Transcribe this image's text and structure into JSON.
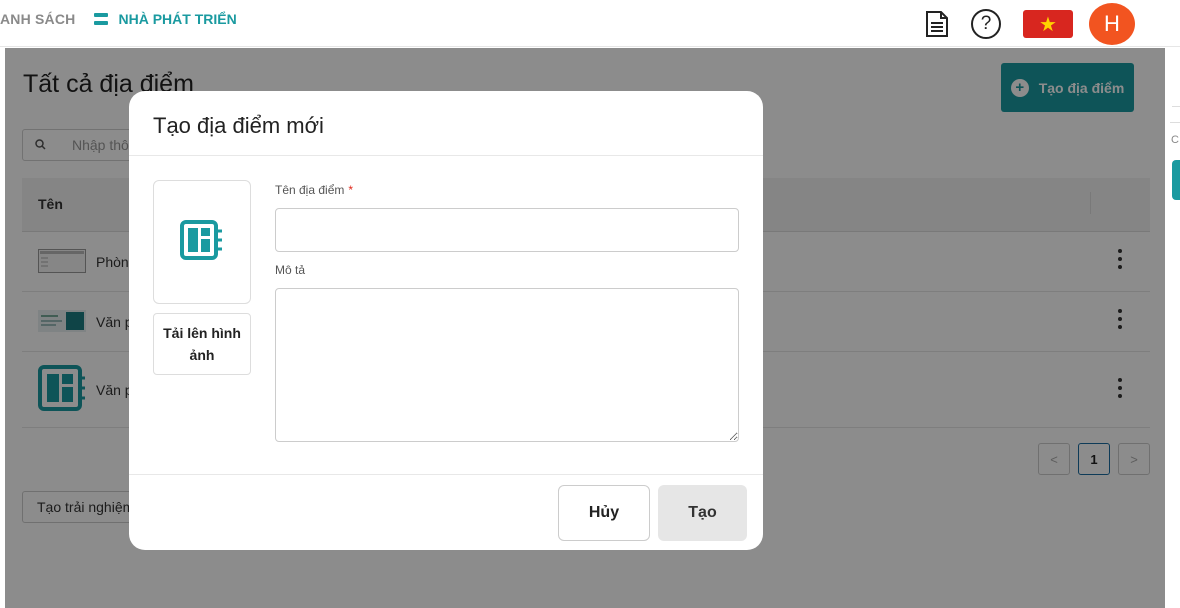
{
  "topbar": {
    "nav_list_label": "ANH SÁCH",
    "nav_dev_label": "NHÀ PHÁT TRIỂN",
    "help_symbol": "?",
    "flag_star": "★",
    "avatar_letter": "H"
  },
  "page": {
    "title": "Tất cả địa điểm",
    "create_button_label": "Tạo địa điểm",
    "search_placeholder": "Nhập thông tin",
    "table": {
      "column_name": "Tên",
      "rows": [
        {
          "name": "Phòng"
        },
        {
          "name": "Văn p"
        },
        {
          "name": "Văn p"
        }
      ]
    },
    "pagination": {
      "prev": "<",
      "current": "1",
      "next": ">"
    },
    "experience_button_label": "Tạo trải nghiệm"
  },
  "right_edge": {
    "letter": "C"
  },
  "modal": {
    "title": "Tạo địa điểm mới",
    "upload_label": "Tải lên hình ảnh",
    "name_label": "Tên địa điểm",
    "required_mark": "*",
    "name_value": "",
    "desc_label": "Mô tả",
    "desc_value": "",
    "cancel_label": "Hủy",
    "create_label": "Tạo"
  },
  "colors": {
    "accent": "#1a9aa0",
    "avatar": "#f25420",
    "flag": "#d8261f",
    "required": "#e0281a"
  }
}
